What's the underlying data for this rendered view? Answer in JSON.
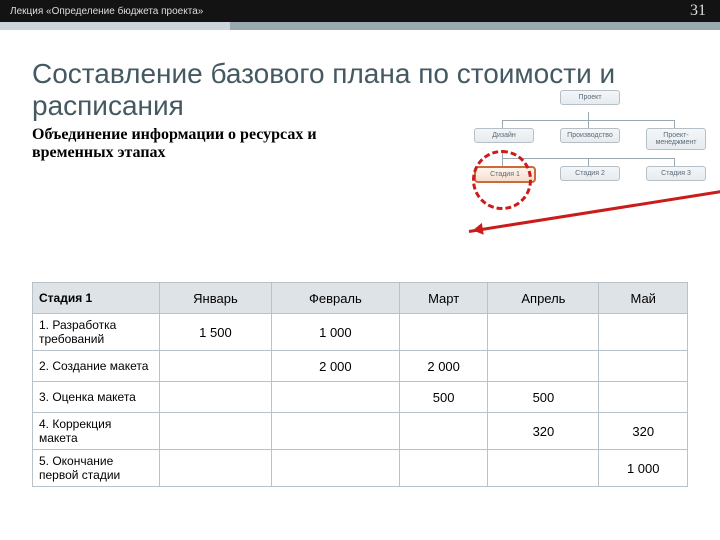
{
  "header": {
    "lecture": "Лекция «Определение бюджета проекта»",
    "page": "31"
  },
  "title": "Составление базового плана по стоимости и расписания",
  "subtitle": "Объединение информации о ресурсах и временных этапах",
  "org": {
    "root": "Проект",
    "mids": [
      "Дизайн",
      "Производство",
      "Проект-менеджмент"
    ],
    "leaves": [
      "Стадия 1",
      "Стадия 2",
      "Стадия 3"
    ]
  },
  "table": {
    "col0": "Стадия 1",
    "cols": [
      "Январь",
      "Февраль",
      "Март",
      "Апрель",
      "Май"
    ],
    "rows": [
      {
        "label": "1. Разработка требований",
        "cells": [
          "1 500",
          "1 000",
          "",
          "",
          ""
        ]
      },
      {
        "label": "2. Создание макета",
        "cells": [
          "",
          "2 000",
          "2 000",
          "",
          ""
        ]
      },
      {
        "label": "3. Оценка макета",
        "cells": [
          "",
          "",
          "500",
          "500",
          ""
        ]
      },
      {
        "label": "4. Коррекция макета",
        "cells": [
          "",
          "",
          "",
          "320",
          "320"
        ]
      },
      {
        "label": "5. Окончание первой стадии",
        "cells": [
          "",
          "",
          "",
          "",
          "1 000"
        ]
      }
    ]
  }
}
